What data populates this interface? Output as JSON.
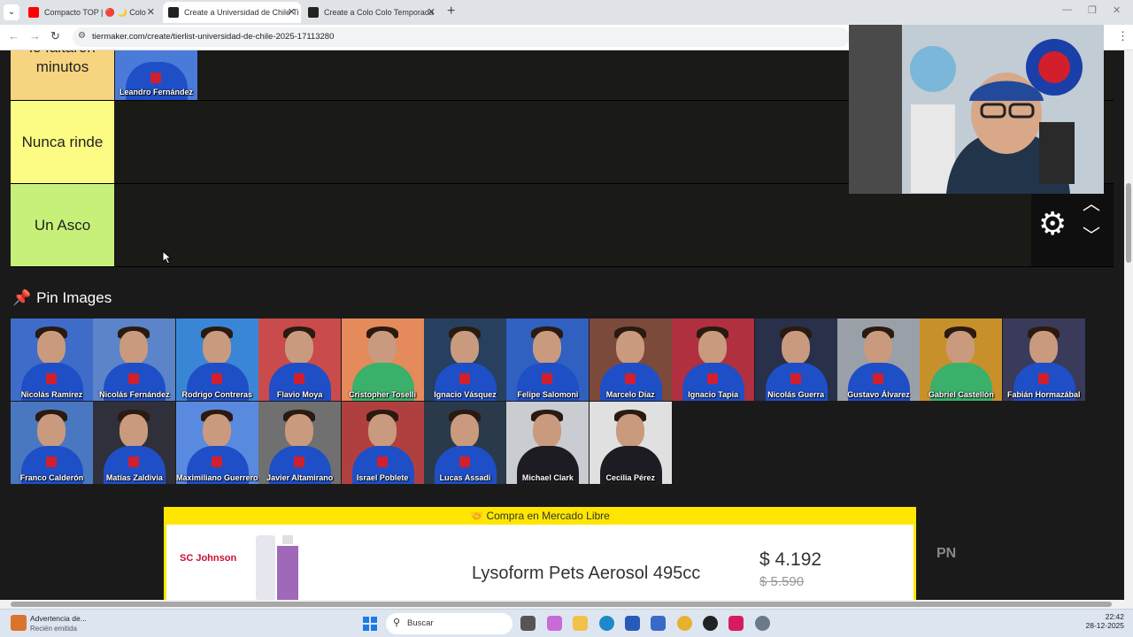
{
  "browser": {
    "tabs": [
      {
        "title": "Compacto TOP | 🔴 🌙 Colo",
        "favicon_color": "#ff0000"
      },
      {
        "title": "Create a Universidad de Chile Ti",
        "favicon_color": "#222222"
      },
      {
        "title": "Create a Colo Colo Temporada",
        "favicon_color": "#222222"
      }
    ],
    "close_glyph": "✕",
    "new_tab_glyph": "+",
    "url": "tiermaker.com/create/tierlist-universidad-de-chile-2025-17113280"
  },
  "tiers": [
    {
      "label": "le faltaron minutos",
      "color": "#f7d480"
    },
    {
      "label": "Nunca rinde",
      "color": "#fcfc84"
    },
    {
      "label": "Un Asco",
      "color": "#c6f07a"
    }
  ],
  "tier_items": [
    {
      "name": "Leandro Fernández",
      "bg": "#4b7bd8"
    }
  ],
  "pin_section": {
    "title": "Pin Images"
  },
  "pool": [
    {
      "name": "Nicolás Ramírez",
      "bg": "#3e6cc8",
      "shirt": "blue"
    },
    {
      "name": "Nicolás Fernández",
      "bg": "#5b84c9",
      "shirt": "blue"
    },
    {
      "name": "Rodrigo Contreras",
      "bg": "#3a86d6",
      "shirt": "blue"
    },
    {
      "name": "Flavio Moya",
      "bg": "#c94b4b",
      "shirt": "blue"
    },
    {
      "name": "Cristopher Toselli",
      "bg": "#e58a5a",
      "shirt": "green"
    },
    {
      "name": "Ignacio Vásquez",
      "bg": "#27405f",
      "shirt": "blue"
    },
    {
      "name": "Felipe Salomoni",
      "bg": "#3060c0",
      "shirt": "blue"
    },
    {
      "name": "Marcelo Díaz",
      "bg": "#7c4a3a",
      "shirt": "blue"
    },
    {
      "name": "Ignacio Tapia",
      "bg": "#b03040",
      "shirt": "blue"
    },
    {
      "name": "Nicolás Guerra",
      "bg": "#28304a",
      "shirt": "blue"
    },
    {
      "name": "Gustavo Álvarez",
      "bg": "#9aa0a8",
      "shirt": "blue"
    },
    {
      "name": "Gabriel Castellón",
      "bg": "#c8902a",
      "shirt": "green"
    },
    {
      "name": "Fabián Hormazábal",
      "bg": "#3a3a5a",
      "shirt": "blue"
    },
    {
      "name": "Franco Calderón",
      "bg": "#4a78c0",
      "shirt": "blue"
    },
    {
      "name": "Matías Zaldivia",
      "bg": "#30303a",
      "shirt": "blue"
    },
    {
      "name": "Maximiliano Guerrero",
      "bg": "#5a8ae0",
      "shirt": "blue"
    },
    {
      "name": "Javier Altamirano",
      "bg": "#707070",
      "shirt": "blue"
    },
    {
      "name": "Israel Poblete",
      "bg": "#b04040",
      "shirt": "blue"
    },
    {
      "name": "Lucas Assadi",
      "bg": "#2a3a4a",
      "shirt": "blue"
    },
    {
      "name": "Michael Clark",
      "bg": "#c9ccd0",
      "shirt": "suit"
    },
    {
      "name": "Cecilia Pérez",
      "bg": "#e0e0e0",
      "shirt": "suit"
    }
  ],
  "ad": {
    "header": "Compra en Mercado Libre",
    "header_icon": "🤝",
    "brand": "SC Johnson",
    "product": "Lysoform Pets Aerosol 495cc",
    "price": "$ 4.192",
    "old_price": "$ 5.590"
  },
  "side_text": "PN",
  "taskbar": {
    "notif_title": "Advertencia de...",
    "notif_sub": "Recién emitida",
    "search_placeholder": "Buscar",
    "time": "22:42",
    "date": "28-12-2025"
  }
}
